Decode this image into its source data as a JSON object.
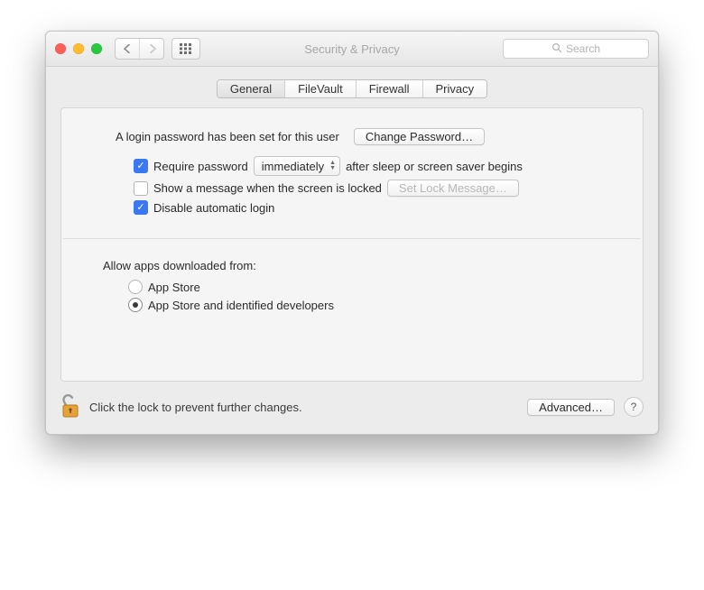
{
  "window_title": "Security & Privacy",
  "search": {
    "placeholder": "Search"
  },
  "tabs": [
    {
      "label": "General",
      "active": true
    },
    {
      "label": "FileVault",
      "active": false
    },
    {
      "label": "Firewall",
      "active": false
    },
    {
      "label": "Privacy",
      "active": false
    }
  ],
  "login": {
    "password_set_text": "A login password has been set for this user",
    "change_password_label": "Change Password…",
    "require_password": {
      "checked": true,
      "prefix": "Require password",
      "delay_value": "immediately",
      "suffix": "after sleep or screen saver begins"
    },
    "show_message": {
      "checked": false,
      "label": "Show a message when the screen is locked",
      "set_message_label": "Set Lock Message…"
    },
    "disable_auto_login": {
      "checked": true,
      "label": "Disable automatic login"
    }
  },
  "gatekeeper": {
    "title": "Allow apps downloaded from:",
    "options": [
      {
        "label": "App Store",
        "selected": false
      },
      {
        "label": "App Store and identified developers",
        "selected": true
      }
    ]
  },
  "footer": {
    "lock_text": "Click the lock to prevent further changes.",
    "advanced_label": "Advanced…",
    "help_label": "?"
  }
}
